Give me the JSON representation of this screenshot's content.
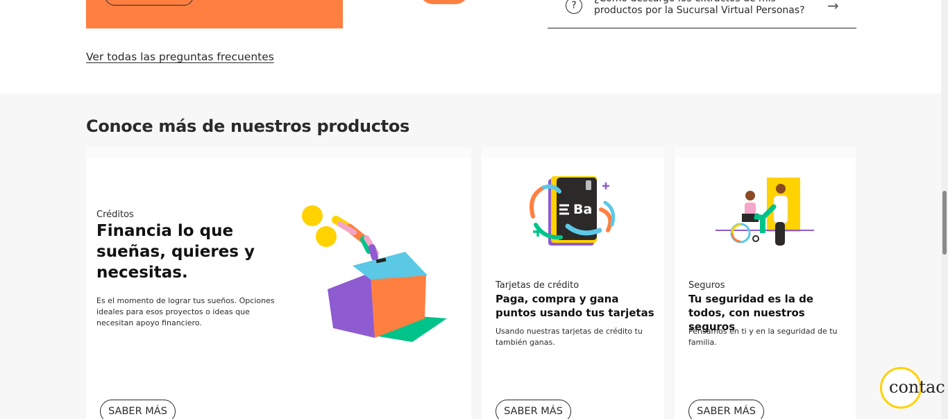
{
  "faq": {
    "question_icon": "?",
    "last_question": "¿Cómo descargo los extractos de mis productos por la Sucursal Virtual Personas?",
    "arrow_icon": "arrow-right-icon",
    "arrow_glyph": "→",
    "view_all_link": "Ver todas las preguntas frecuentes"
  },
  "products": {
    "title": "Conoce más de nuestros productos",
    "cards": [
      {
        "eyebrow": "Créditos",
        "headline": "Financia lo que sueñas, quieres y necesitas.",
        "description": "Es el momento de lograr tus sueños. Opciones ideales para esos proyectos o ideas que necesitan apoyo financiero.",
        "button": "SABER MÁS"
      },
      {
        "eyebrow": "Tarjetas de crédito",
        "headline": "Paga, compra y gana puntos usando tus tarjetas",
        "description": "Usando nuestras tarjetas de crédito tu también ganas.",
        "button": "SABER MÁS",
        "card_logo": "Ba"
      },
      {
        "eyebrow": "Seguros",
        "headline": "Tu seguridad es la de todos, con nuestros seguros",
        "description": "Pensamos en ti y en la seguridad de tu familia.",
        "button": "SABER MÁS"
      }
    ]
  },
  "chat": {
    "label": "contac"
  },
  "colors": {
    "orange": "#ff7f41",
    "yellow": "#ffd200",
    "teal": "#5bc8e6",
    "purple": "#8e5bd0",
    "green": "#00c389",
    "pink": "#f4a6c8"
  }
}
